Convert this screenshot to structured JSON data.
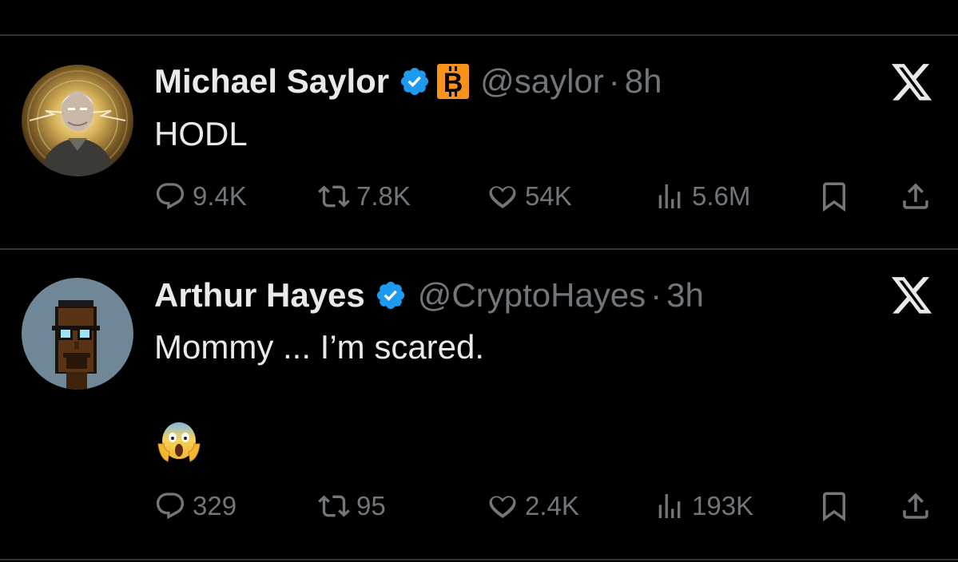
{
  "tweets": [
    {
      "name": "Michael Saylor",
      "handle": "@saylor",
      "separator": "·",
      "time": "8h",
      "text": "HODL",
      "verified": true,
      "bitcoin_badge": true,
      "avatar": "portrait-with-glowing-aura",
      "stats": {
        "replies": "9.4K",
        "reposts": "7.8K",
        "likes": "54K",
        "views": "5.6M"
      }
    },
    {
      "name": "Arthur Hayes",
      "handle": "@CryptoHayes",
      "separator": "·",
      "time": "3h",
      "text": "Mommy ... I’m scared.",
      "emoji": "😱",
      "verified": true,
      "bitcoin_badge": false,
      "avatar": "pixel-art-punk",
      "stats": {
        "replies": "329",
        "reposts": "95",
        "likes": "2.4K",
        "views": "193K"
      }
    }
  ],
  "icons": {
    "reply": "speech-bubble-icon",
    "repost": "repost-arrows-icon",
    "like": "heart-icon",
    "views": "bar-chart-icon",
    "bookmark": "bookmark-icon",
    "share": "share-upload-icon",
    "platform": "x-logo-icon"
  },
  "colors": {
    "background": "#000000",
    "text": "#e7e9ea",
    "muted": "#71767b",
    "divider": "#2f3336",
    "verified": "#1d9bf0",
    "bitcoin": "#f7931a"
  }
}
